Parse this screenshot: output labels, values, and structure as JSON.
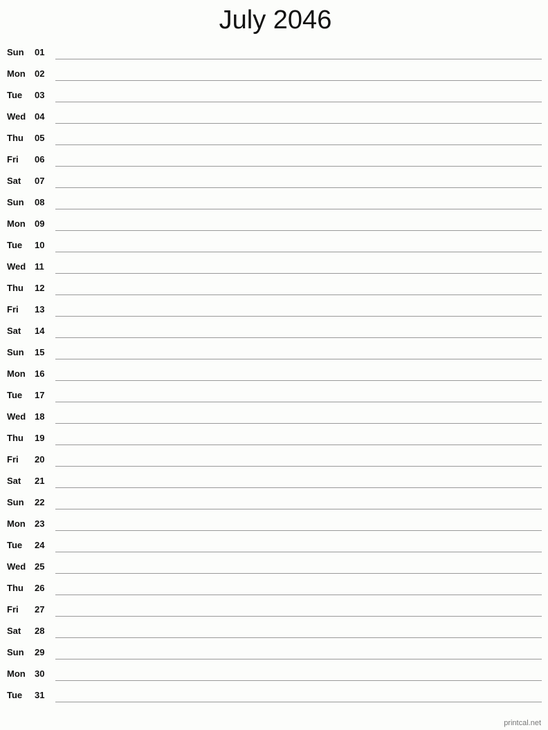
{
  "header": {
    "title": "July 2046"
  },
  "days": [
    {
      "dow": "Sun",
      "day": "01"
    },
    {
      "dow": "Mon",
      "day": "02"
    },
    {
      "dow": "Tue",
      "day": "03"
    },
    {
      "dow": "Wed",
      "day": "04"
    },
    {
      "dow": "Thu",
      "day": "05"
    },
    {
      "dow": "Fri",
      "day": "06"
    },
    {
      "dow": "Sat",
      "day": "07"
    },
    {
      "dow": "Sun",
      "day": "08"
    },
    {
      "dow": "Mon",
      "day": "09"
    },
    {
      "dow": "Tue",
      "day": "10"
    },
    {
      "dow": "Wed",
      "day": "11"
    },
    {
      "dow": "Thu",
      "day": "12"
    },
    {
      "dow": "Fri",
      "day": "13"
    },
    {
      "dow": "Sat",
      "day": "14"
    },
    {
      "dow": "Sun",
      "day": "15"
    },
    {
      "dow": "Mon",
      "day": "16"
    },
    {
      "dow": "Tue",
      "day": "17"
    },
    {
      "dow": "Wed",
      "day": "18"
    },
    {
      "dow": "Thu",
      "day": "19"
    },
    {
      "dow": "Fri",
      "day": "20"
    },
    {
      "dow": "Sat",
      "day": "21"
    },
    {
      "dow": "Sun",
      "day": "22"
    },
    {
      "dow": "Mon",
      "day": "23"
    },
    {
      "dow": "Tue",
      "day": "24"
    },
    {
      "dow": "Wed",
      "day": "25"
    },
    {
      "dow": "Thu",
      "day": "26"
    },
    {
      "dow": "Fri",
      "day": "27"
    },
    {
      "dow": "Sat",
      "day": "28"
    },
    {
      "dow": "Sun",
      "day": "29"
    },
    {
      "dow": "Mon",
      "day": "30"
    },
    {
      "dow": "Tue",
      "day": "31"
    }
  ],
  "footer": {
    "credit": "printcal.net"
  }
}
